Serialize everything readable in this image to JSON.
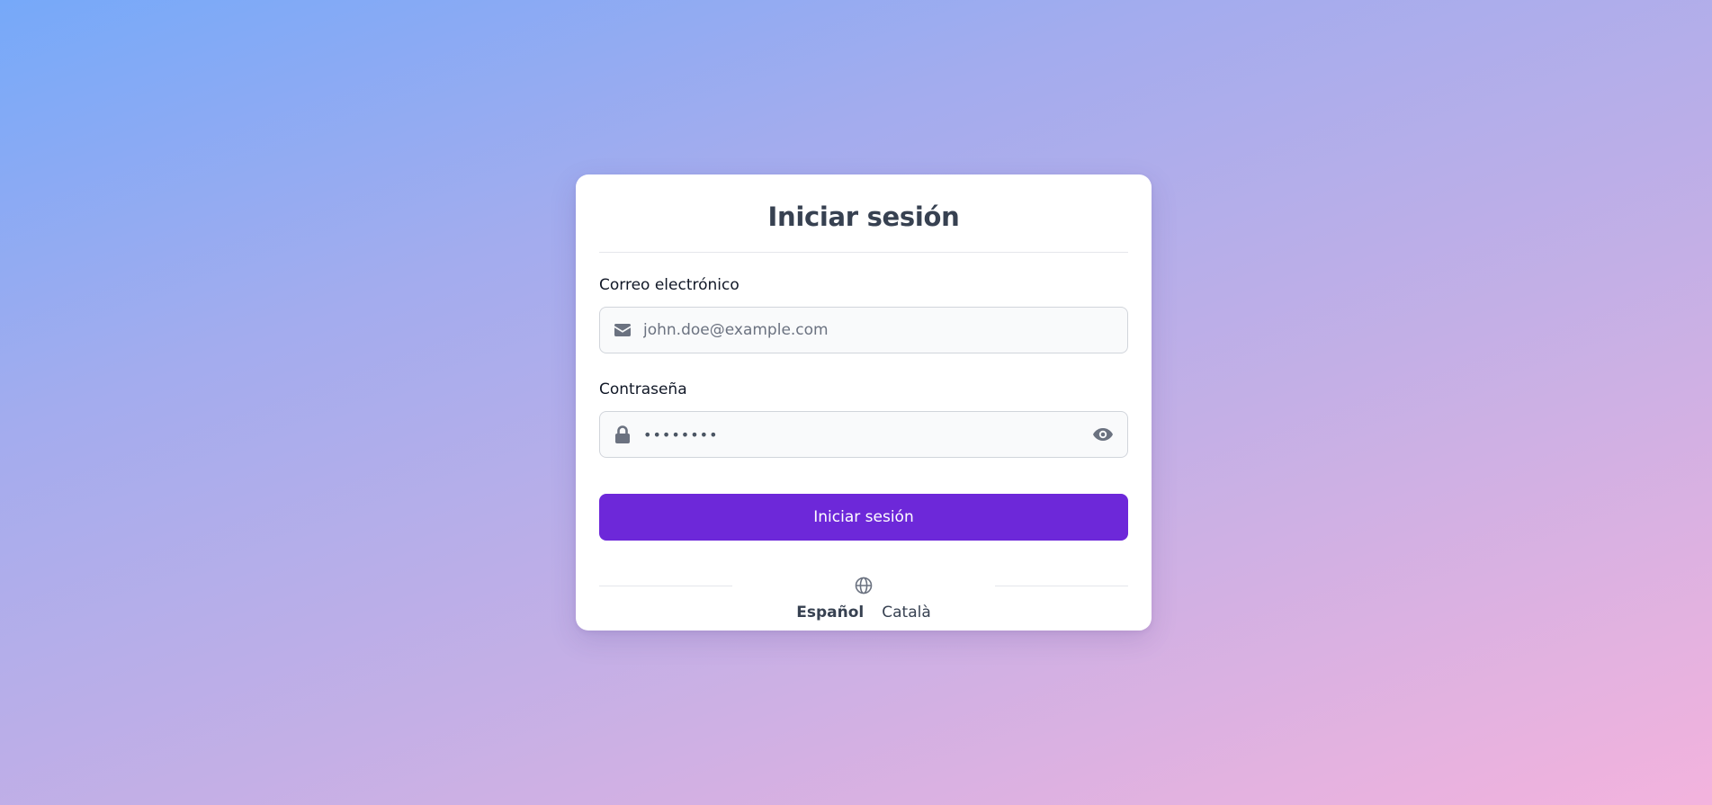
{
  "login": {
    "title": "Iniciar sesión",
    "email": {
      "label": "Correo electrónico",
      "placeholder": "john.doe@example.com",
      "icon": "envelope-icon"
    },
    "password": {
      "label": "Contraseña",
      "value": "••••••••",
      "icon": "lock-icon",
      "toggle_icon": "eye-icon"
    },
    "submit_label": "Iniciar sesión"
  },
  "language": {
    "icon": "globe-icon",
    "options": [
      {
        "label": "Español",
        "active": true
      },
      {
        "label": "Català",
        "active": false
      }
    ]
  },
  "colors": {
    "accent": "#6d28d9",
    "title": "#374151",
    "gradient_start": "#76a9f9",
    "gradient_end": "#f3b3dd"
  }
}
